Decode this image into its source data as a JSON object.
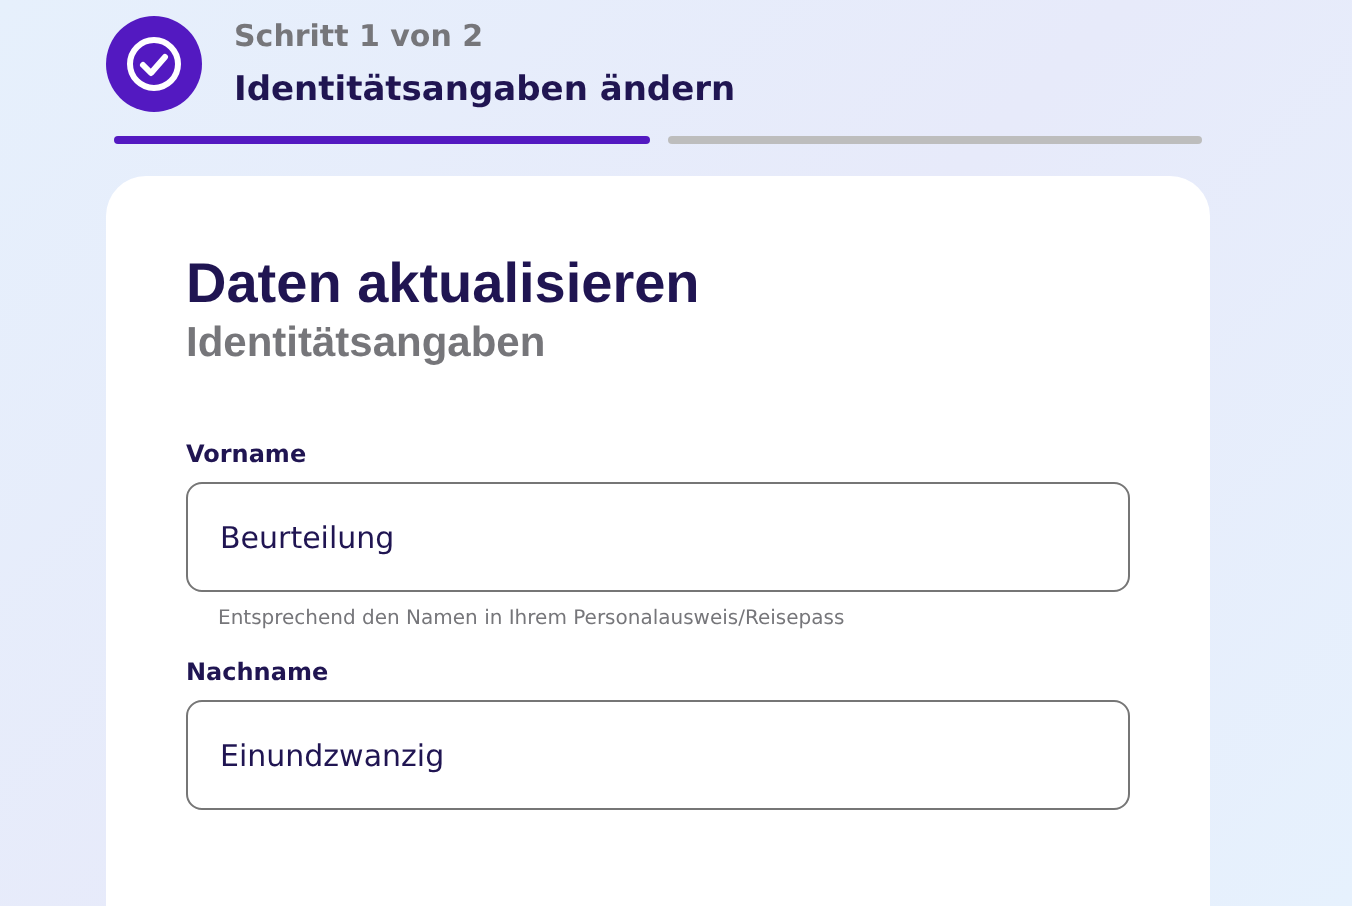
{
  "stepper": {
    "step_label": "Schritt 1 von 2",
    "title": "Identitätsangaben ändern",
    "done": true,
    "segments": [
      {
        "completed": true
      },
      {
        "completed": false
      }
    ]
  },
  "card": {
    "title": "Daten aktualisieren",
    "subtitle": "Identitätsangaben",
    "fields": [
      {
        "label": "Vorname",
        "value": "Beurteilung",
        "hint": "Entsprechend den Namen in Ihrem Personalausweis/Reisepass"
      },
      {
        "label": "Nachname",
        "value": "Einundzwanzig"
      }
    ]
  }
}
